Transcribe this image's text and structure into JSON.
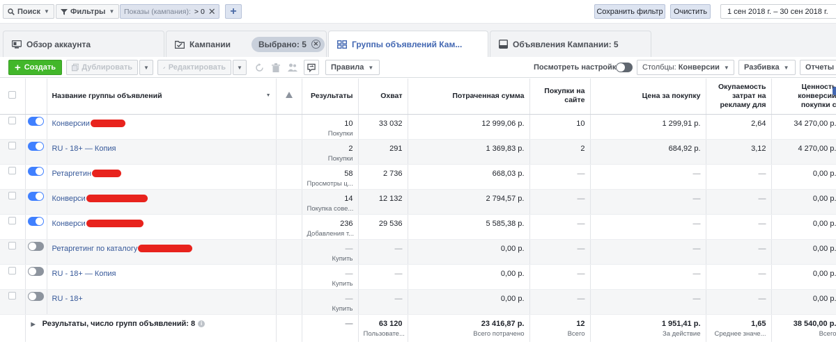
{
  "filterbar": {
    "search_label": "Поиск",
    "filters_label": "Фильтры",
    "chip_field": "Показы (кампания):",
    "chip_op": "> 0",
    "save_filter": "Сохранить фильтр",
    "clear": "Очистить",
    "date_range": "1 сен 2018 г. – 30 сен 2018 г."
  },
  "tabs": [
    {
      "label": "Обзор аккаунта",
      "icon": "monitor-icon"
    },
    {
      "label": "Кампании",
      "icon": "folder-icon",
      "selected_label": "Выбрано: 5"
    },
    {
      "label": "Группы объявлений Кам...",
      "icon": "grid-icon",
      "active": true
    },
    {
      "label": "Объявления Кампании: 5",
      "icon": "ad-icon"
    }
  ],
  "toolbar": {
    "create": "Создать",
    "duplicate": "Дублировать",
    "edit": "Редактировать",
    "rules": "Правила",
    "view_settings": "Посмотреть настройки",
    "columns_prefix": "Столбцы:",
    "columns_value": "Конверсии",
    "breakdown": "Разбивка",
    "reports": "Отчеты"
  },
  "table": {
    "headers": {
      "name": "Название группы объявлений",
      "results": "Результаты",
      "reach": "Охват",
      "spent": "Потраченная сумма",
      "purchases": "Покупки на сайте",
      "cpp": "Цена за покупку",
      "roas": "Окупаемость затрат на рекламу для",
      "value": "Ценность конверсии покупки с"
    },
    "rows": [
      {
        "on": true,
        "name": "Конверсии",
        "redact_w": 50,
        "results": "10",
        "results_sub": "Покупки",
        "reach": "33 032",
        "spent": "12 999,06 р.",
        "purchases": "10",
        "cpp": "1 299,91 р.",
        "roas": "2,64",
        "value": "34 270,00 р."
      },
      {
        "on": true,
        "name": "RU - 18+ — Копия",
        "redact_w": 0,
        "results": "2",
        "results_sub": "Покупки",
        "reach": "291",
        "spent": "1 369,83 р.",
        "purchases": "2",
        "cpp": "684,92 р.",
        "roas": "3,12",
        "value": "4 270,00 р."
      },
      {
        "on": true,
        "name": "Ретаргетин",
        "redact_w": 42,
        "results": "58",
        "results_sub": "Просмотры ц...",
        "reach": "2 736",
        "spent": "668,03 р.",
        "purchases": "—",
        "cpp": "—",
        "roas": "—",
        "value": "0,00 р."
      },
      {
        "on": true,
        "name": "Конверси",
        "redact_w": 88,
        "results": "14",
        "results_sub": "Покупка сове...",
        "reach": "12 132",
        "spent": "2 794,57 р.",
        "purchases": "—",
        "cpp": "—",
        "roas": "—",
        "value": "0,00 р."
      },
      {
        "on": true,
        "name": "Конверси",
        "redact_w": 82,
        "results": "236",
        "results_sub": "Добавления т...",
        "reach": "29 536",
        "spent": "5 585,38 р.",
        "purchases": "—",
        "cpp": "—",
        "roas": "—",
        "value": "0,00 р."
      },
      {
        "on": false,
        "name": "Ретаргетинг по каталогу",
        "redact_w": 78,
        "results": "—",
        "results_sub": "Купить",
        "reach": "—",
        "spent": "0,00 р.",
        "purchases": "—",
        "cpp": "—",
        "roas": "—",
        "value": "0,00 р."
      },
      {
        "on": false,
        "name": "RU - 18+ — Копия",
        "redact_w": 0,
        "results": "—",
        "results_sub": "Купить",
        "reach": "—",
        "spent": "0,00 р.",
        "purchases": "—",
        "cpp": "—",
        "roas": "—",
        "value": "0,00 р."
      },
      {
        "on": false,
        "name": "RU - 18+",
        "redact_w": 0,
        "results": "—",
        "results_sub": "Купить",
        "reach": "—",
        "spent": "0,00 р.",
        "purchases": "—",
        "cpp": "—",
        "roas": "—",
        "value": "0,00 р."
      }
    ],
    "summary": {
      "label": "Результаты, число групп объявлений: 8",
      "results": "—",
      "reach": "63 120",
      "reach_sub": "Пользовате...",
      "spent": "23 416,87 р.",
      "spent_sub": "Всего потрачено",
      "purchases": "12",
      "purchases_sub": "Всего",
      "cpp": "1 951,41 р.",
      "cpp_sub": "За действие",
      "roas": "1,65",
      "roas_sub": "Среднее значе...",
      "value": "38 540,00 р.",
      "value_sub": "Всего"
    }
  },
  "colors": {
    "link": "#365899",
    "toggle_on": "#4080ff",
    "create_green": "#42b72a",
    "active_tab": "#4267b2",
    "redaction": "#e8231d"
  }
}
